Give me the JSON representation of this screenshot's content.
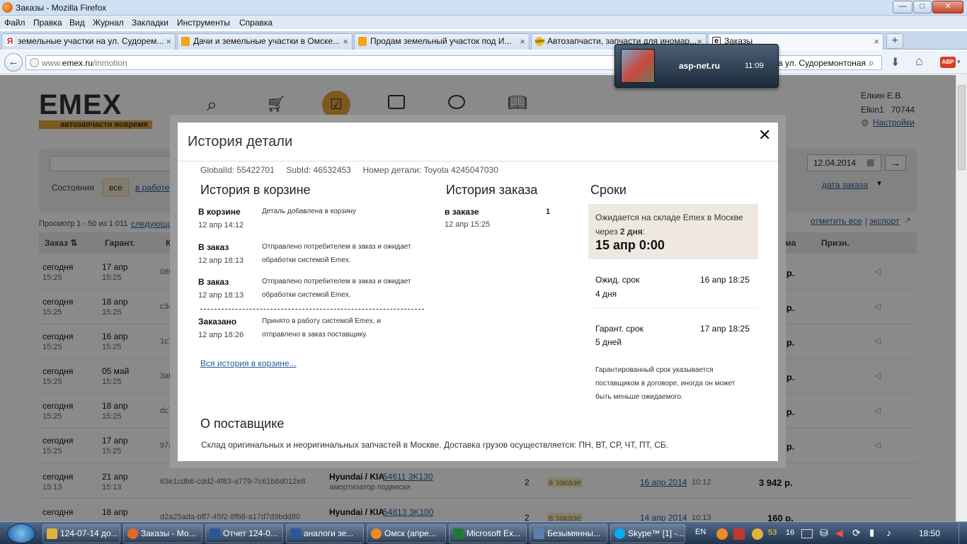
{
  "window": {
    "title": "Заказы - Mozilla Firefox",
    "controls": [
      "—",
      "□",
      "✕"
    ]
  },
  "menu": [
    "Файл",
    "Правка",
    "Вид",
    "Журнал",
    "Закладки",
    "Инструменты",
    "Справка"
  ],
  "tabs": [
    {
      "label": "земельные участки на ул. Судорем...",
      "color": "#d12a2a"
    },
    {
      "label": "Дачи и земельные участки в Омске...",
      "color": "#f3a417"
    },
    {
      "label": "Продам земельный участок под И...",
      "color": "#f3a417"
    },
    {
      "label": "Автозапчасти, запчасти для иномар...",
      "color": "#f3c417",
      "badge": "шел"
    },
    {
      "label": "Заказы",
      "color": "#333333",
      "badge": "e"
    }
  ],
  "new_tab": "+",
  "url": {
    "prefix": "www.",
    "domain": "emex.ru",
    "path": "/inmotion"
  },
  "search_value": "а ул. Судоремонтоная",
  "skype_popup": {
    "site": "asp-net.ru",
    "time": "11:09"
  },
  "site": {
    "logo": "EMEX",
    "slogan": "автозапчасти вовремя",
    "user_name": "Елкин Е.В.",
    "user_login": "Elkin1",
    "user_code": "70744",
    "settings": "Настройки"
  },
  "filters": {
    "date_to": "12.04.2014",
    "date_sep": "—",
    "go": "→",
    "states_label": "Состояния",
    "state_all": "все",
    "state_work": "в работе",
    "sort": "дата заказа"
  },
  "list": {
    "summary": "Просмотр 1 - 50 из 1 011",
    "next": "следующая",
    "mark_all": "отметить все",
    "separator": "|",
    "export": "экспорт",
    "headers": {
      "order": "Заказ",
      "guar": "Гарант.",
      "code": "Ко",
      "sum": "мма",
      "sign": "Призн."
    },
    "rows": [
      {
        "day": "сегодня",
        "time": "15:25",
        "g": "17 апр",
        "gt": "15:25",
        "code": "089a",
        "sum": "3 р."
      },
      {
        "day": "сегодня",
        "time": "15:25",
        "g": "18 апр",
        "gt": "15:25",
        "code": "c349",
        "sum": "2 р."
      },
      {
        "day": "сегодня",
        "time": "15:25",
        "g": "16 апр",
        "gt": "15:25",
        "code": "1c79",
        "sum": "0 р."
      },
      {
        "day": "сегодня",
        "time": "15:25",
        "g": "05 май",
        "gt": "15:25",
        "code": "3af8",
        "sum": "8 р."
      },
      {
        "day": "сегодня",
        "time": "15:25",
        "g": "18 апр",
        "gt": "15:25",
        "code": "dc77",
        "sum": "9 р."
      },
      {
        "day": "сегодня",
        "time": "15:25",
        "g": "17 апр",
        "gt": "15:25",
        "code": "97ab",
        "sum": "2 р."
      },
      {
        "day": "сегодня",
        "time": "15:13",
        "g": "21 апр",
        "gt": "15:13",
        "code": "63e1cdb6-cdd2-4f83-a779-7c61b8d012e8",
        "brand": "Hyundai / KIA",
        "part": "54611 3K130",
        "desc": "амортизатор подвески",
        "qty": "2",
        "status": "в заказе",
        "date": "16 апр 2014",
        "dtime": "10:12",
        "sum": "3 942 р."
      },
      {
        "day": "сегодня",
        "time": "15:13",
        "g": "18 апр",
        "gt": "15:13",
        "code": "d2a25ada-bff7-45f2-8fb8-a17d7d9bdd80",
        "brand": "Hyundai / KIA",
        "part": "54813 3K100",
        "desc": "",
        "qty": "2",
        "status": "в заказе",
        "date": "14 апр 2014",
        "dtime": "10:13",
        "sum": "160 р."
      }
    ]
  },
  "modal": {
    "title": "История детали",
    "close": "✕",
    "ids": "GlobalId: 55422701     SubId: 46532453     Номер детали: Toyota 4245047030",
    "cart_title": "История в корзине",
    "cart_events": [
      {
        "title": "В корзине",
        "date": "12 апр 14:12",
        "text1": "Деталь добавлена в корзину",
        "text2": ""
      },
      {
        "title": "В заказ",
        "date": "12 апр 18:13",
        "text1": "Отправлено потребителем в заказ и ожидает",
        "text2": "обработки системой Emex."
      },
      {
        "title": "В заказ",
        "date": "12 апр 18:13",
        "text1": "Отправлено потребителем в заказ и ожидает",
        "text2": "обработки системой Emex."
      },
      {
        "title": "Заказано",
        "date": "12 апр 18:26",
        "text1": "Принято в работу системой Emex, и",
        "text2": "отправлено в заказ поставщику."
      }
    ],
    "cart_all_link": "Вся история в корзине...",
    "order_title": "История заказа",
    "order_event": {
      "title": "в заказе",
      "date": "12 апр 15:25",
      "count": "1"
    },
    "terms_title": "Сроки",
    "expected_box": {
      "line1": "Ожидается на складе Emex в Москве",
      "line2a": "через",
      "line2b": "2 дня",
      "line2c": ":",
      "big": "15 апр 0:00"
    },
    "exp_term": {
      "label": "Ожид. срок",
      "date": "16 апр 18:25",
      "sub": "4 дня"
    },
    "guar_term": {
      "label": "Гарант. срок",
      "date": "17 апр 18:25",
      "sub": "5 дней"
    },
    "note": [
      "Гарантированный срок указывается",
      "поставщиком в договоре, иногда он может",
      "быть меньше ожидаемого."
    ],
    "supplier_title": "О поставщике",
    "supplier_text": "Склад оригинальных и неоригинальных запчастей в Москве. Доставка грузов осуществляется: ПН, ВТ, СР, ЧТ, ПТ, СБ."
  },
  "taskbar": {
    "items": [
      {
        "label": "124-07-14 до...",
        "color": "#e3b23c"
      },
      {
        "label": "Заказы - Мо...",
        "color": "#e1692a"
      },
      {
        "label": "Отчет 124-0...",
        "color": "#2b5797"
      },
      {
        "label": "аналоги зе...",
        "color": "#2b5797"
      },
      {
        "label": "Омск (апре...",
        "color": "#f08a24"
      },
      {
        "label": "Microsoft Ex...",
        "color": "#1f7a3a"
      },
      {
        "label": "Безымянны...",
        "color": "#5a7fb0"
      },
      {
        "label": "Skype™ [1] -...",
        "color": "#00aff0"
      }
    ],
    "lang": "EN",
    "tray_a": "53",
    "tray_b": "16",
    "clock": "18:50"
  }
}
